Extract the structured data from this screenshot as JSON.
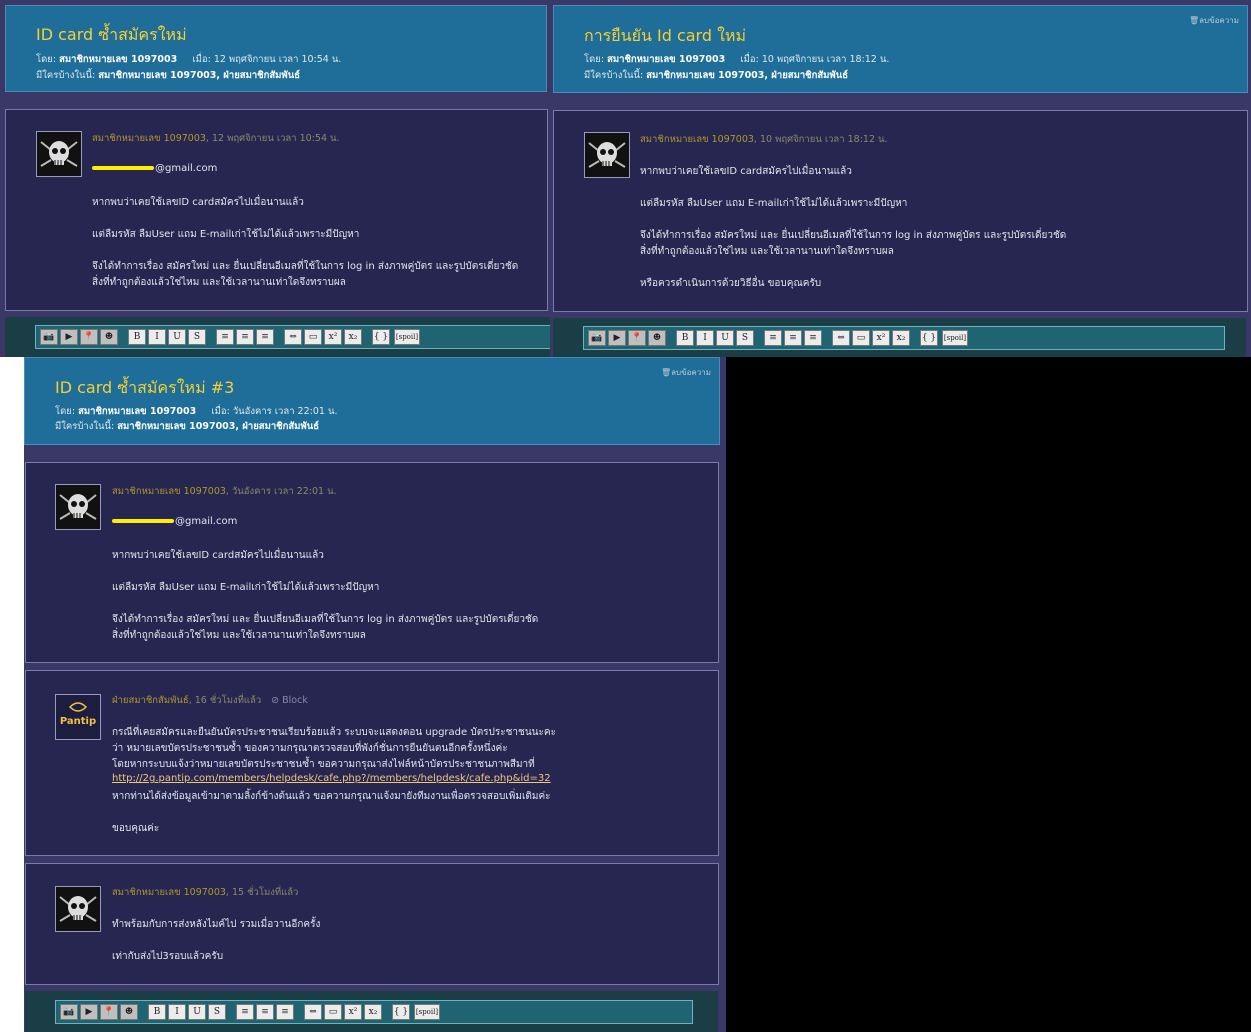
{
  "common": {
    "by_label": "โดย:",
    "member": "สมาชิกหมายเลข 1097003",
    "when_label": "เมื่อ:",
    "who_label": "มีใครบ้างในนี้:",
    "who_value": "สมาชิกหมายเลข 1097003, ฝ่ายสมาชิกสัมพันธ์",
    "delete_label": "ลบข้อความ",
    "email_suffix": "@gmail.com",
    "toolbar": [
      "📷",
      "▶",
      "📍",
      "☻",
      "B",
      "I",
      "U",
      "S",
      "≡",
      "≡",
      "≡",
      "⇔",
      "▭",
      "x²",
      "x₂",
      "{ }",
      "[spoil]"
    ]
  },
  "panel1": {
    "title": "ID card ซ้ำสมัครใหม่",
    "date": "12 พฤศจิกายน เวลา 10:54 น.",
    "post_head_date": ", 12 พฤศจิกายน เวลา 10:54 น.",
    "lines": [
      "หากพบว่าเคยใช้เลขID cardสมัครไปเมื่อนานแล้ว",
      "แต่ลืมรหัส ลืมUser แถม E-mailเก่าใช้ไม่ได้แล้วเพราะมีปัญหา",
      "จึงได้ทำการเรื่อง สมัครใหม่ และ ยื่นเปลี่ยนอีเมลที่ใช้ในการ log in ส่งภาพคู่บัตร และรูปบัตรเดี่ยวชัด",
      "สิ่งที่ทำถูกต้องแล้วใช่ไหม และใช้เวลานานเท่าใดจึงทราบผล"
    ]
  },
  "panel2": {
    "title": "การยืนยัน Id card ใหม่",
    "date": "10 พฤศจิกายน เวลา 18:12 น.",
    "post_head_date": ", 10 พฤศจิกายน เวลา 18:12 น.",
    "lines": [
      "หากพบว่าเคยใช้เลขID cardสมัครไปเมื่อนานแล้ว",
      "แต่ลืมรหัส ลืมUser แถม E-mailเก่าใช้ไม่ได้แล้วเพราะมีปัญหา",
      "จึงได้ทำการเรื่อง สมัครใหม่ และ ยื่นเปลี่ยนอีเมลที่ใช้ในการ log in ส่งภาพคู่บัตร และรูปบัตรเดี่ยวชัด",
      "สิ่งที่ทำถูกต้องแล้วใช่ไหม และใช้เวลานานเท่าใดจึงทราบผล",
      "หรือควรดำเนินการด้วยวิธีอื่น ขอบคุณครับ"
    ]
  },
  "panel3": {
    "title": "ID card ซ้ำสมัครใหม่ #3",
    "date": "วันอังคาร เวลา 22:01 น.",
    "post_head_date": ", วันอังคาร เวลา 22:01 น.",
    "lines": [
      "หากพบว่าเคยใช้เลขID cardสมัครไปเมื่อนานแล้ว",
      "แต่ลืมรหัส ลืมUser แถม E-mailเก่าใช้ไม่ได้แล้วเพราะมีปัญหา",
      "จึงได้ทำการเรื่อง สมัครใหม่ และ ยื่นเปลี่ยนอีเมลที่ใช้ในการ log in ส่งภาพคู่บัตร และรูปบัตรเดี่ยวชัด",
      "สิ่งที่ทำถูกต้องแล้วใช่ไหม และใช้เวลานานเท่าใดจึงทราบผล"
    ],
    "reply1": {
      "name": "ฝ่ายสมาชิกสัมพันธ์",
      "time": ", 16 ชั่วโมงที่แล้ว",
      "block": "⊘ Block",
      "logo_text": "Pantip",
      "lines": [
        "กรณีที่เคยสมัครและยืนยันบัตรประชาชนเรียบร้อยแล้ว ระบบจะแสดงตอน upgrade บัตรประชาชนนะคะ",
        "ว่า หมายเลขบัตรประชาชนซ้ำ ของความกรุณาตรวจสอบที่พังก์ชั่นการยืนยันตนอีกครั้งหนึ่งค่ะ",
        "โดยหากระบบแจ้งว่าหมายเลขบัตรประชาชนซ้ำ ขอความกรุณาส่งไฟล์หน้าบัตรประชาชนภาพสีมาที่"
      ],
      "link": "http://2g.pantip.com/members/helpdesk/cafe.php?/members/helpdesk/cafe.php&id=32",
      "after_link": "หากท่านได้ส่งข้อมูลเข้ามาตามลิ้งก์ข้างต้นแล้ว ขอความกรุณาแจ้งมายังทีมงานเพื่อตรวจสอบเพิ่มเติมค่ะ",
      "thanks": "ขอบคุณค่ะ"
    },
    "reply2": {
      "time": ", 15 ชั่วโมงที่แล้ว",
      "lines": [
        "ทำพร้อมกับการส่งหลังไมค์ไป รวมเมื่อวานอีกครั้ง",
        "เท่ากับส่งไป3รอบแล้วครับ"
      ]
    }
  }
}
